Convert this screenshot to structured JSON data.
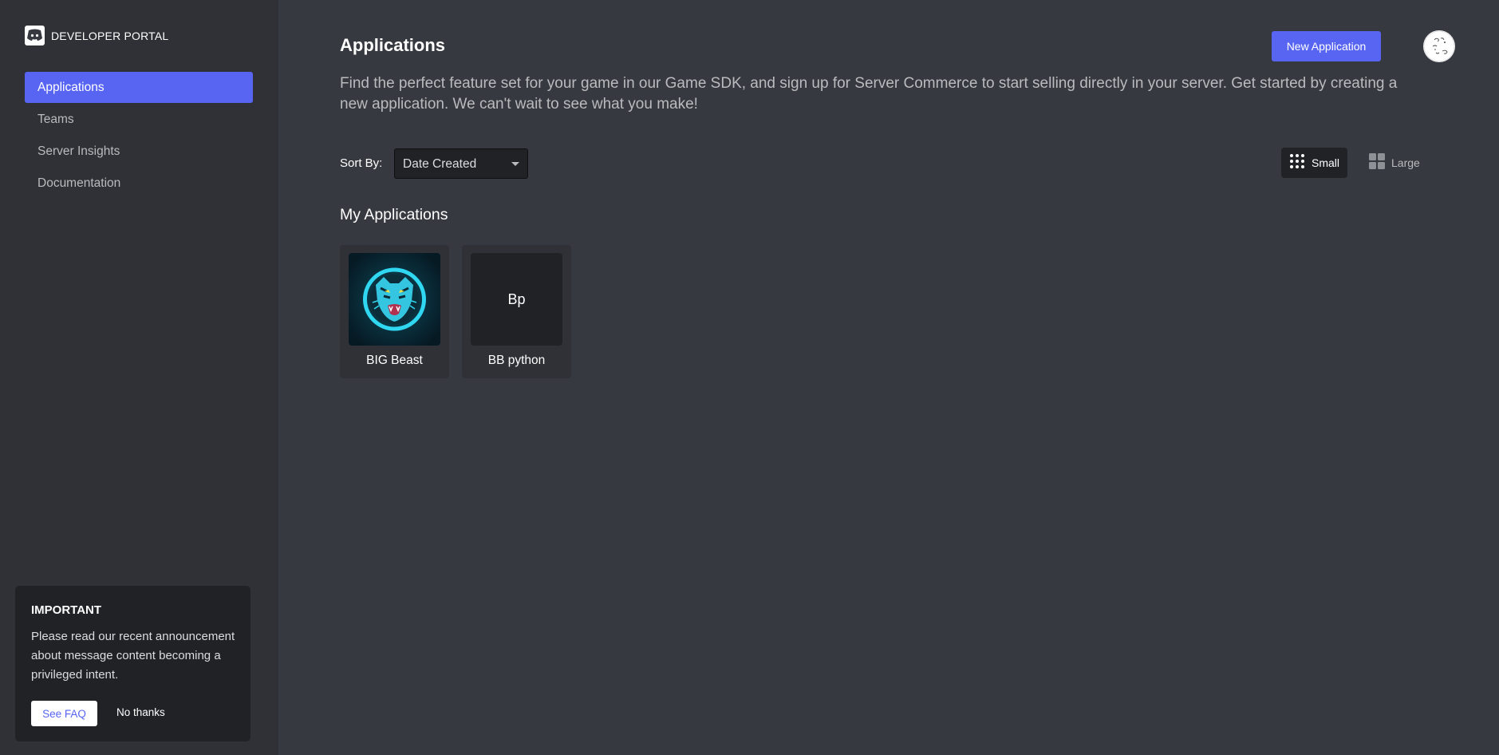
{
  "brand": {
    "title": "DEVELOPER PORTAL"
  },
  "sidebar": {
    "items": [
      {
        "label": "Applications",
        "active": true
      },
      {
        "label": "Teams",
        "active": false
      },
      {
        "label": "Server Insights",
        "active": false
      },
      {
        "label": "Documentation",
        "active": false
      }
    ]
  },
  "notice": {
    "title": "IMPORTANT",
    "body": "Please read our recent announcement about message content becoming a privileged intent.",
    "faq_label": "See FAQ",
    "dismiss_label": "No thanks"
  },
  "header": {
    "title": "Applications",
    "new_app_label": "New Application"
  },
  "main": {
    "description": "Find the perfect feature set for your game in our Game SDK, and sign up for Server Commerce to start selling directly in your server. Get started by creating a new application. We can't wait to see what you make!",
    "sort_label": "Sort By:",
    "sort_value": "Date Created",
    "size_small_label": "Small",
    "size_large_label": "Large",
    "section_title": "My Applications",
    "apps": [
      {
        "name": "BIG Beast",
        "icon": "tiger-icon"
      },
      {
        "name": "BB python",
        "icon_text": "Bp"
      }
    ]
  },
  "colors": {
    "accent": "#5865f2",
    "sidebar_bg": "#2f3136",
    "main_bg": "#36393f",
    "card_bg": "#202225"
  }
}
